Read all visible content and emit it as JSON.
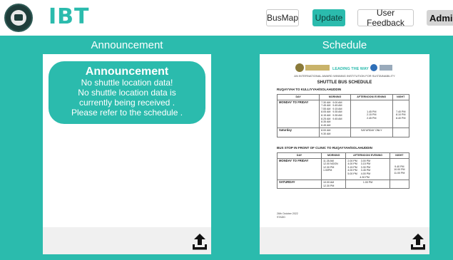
{
  "header": {
    "brand": "IBT",
    "nav": {
      "busmap": "BusMap",
      "update": "Update",
      "feedback": "User Feedback",
      "admin": "Admi"
    }
  },
  "colors": {
    "teal": "#2bbbad",
    "dark": "#1f3d3a"
  },
  "left_panel": {
    "title": "Announcement",
    "bubble_title": "Announcement",
    "lines": [
      "No shuttle location data!",
      "No shuttle location data is",
      "currently being received .",
      "Please refer to the schedule ."
    ],
    "icon": "upload-icon"
  },
  "right_panel": {
    "title": "Schedule",
    "icon": "upload-icon",
    "doc": {
      "caption": "AN INTERNATIONAL AWARD WINNING INSTITUTION FOR SUSTAINABILITY",
      "logo_text": "LEADING THE WAY",
      "title": "SHUTTLE BUS SCHEDULE",
      "route1": "RUQAYYAH TO KULLIYYAH/SOLAHUDDIN",
      "route2": "BUS STOP IN FRONT OF CLINIC TO RUQAYYAH/SOLAHUDDIN",
      "headers": [
        "DAY",
        "MORNING",
        "AFTERNOON/ EVENING",
        "NIGHT"
      ],
      "t1": {
        "weekday": "MONDAY TO FRIDAY",
        "morning": "7.30 AM   9.00 AM\n7.45 AM   9.45 AM\n7.55 AM   9.15 AM\n8.05 AM   9.35 AM\n8.15 AM   9.35 AM\n8.25 AM   9.45 AM\n8.35 AM\n8.45 AM",
        "afternoon": "1.45 PM\n2.15 PM\n2.45 PM",
        "night": "7.40 PM\n8.10 PM\n8.40 PM",
        "saturday": "Saturday",
        "sat_morning": "8.00 AM\n9.30 AM",
        "sat_afternoon": "SATURDAY ONLY"
      },
      "t2": {
        "weekday": "MONDAY TO FRIDAY",
        "morning": "11.35 AM\n12.00 NOON\n12.30 PM\n1.00PM",
        "afternoon": "2.00 PM     3.00 PM\n4.00 PM     3.15 PM\n3.15 PM     3.30 PM\n4.00 PM     3.45 PM\n5.00 PM     4.00 PM\n                 4.30 PM",
        "night": "9.40 PM\n10.00 PM\n11.00 PM",
        "saturday": "SATURDAY",
        "sat_morning": "10.00 AM\n12.30 PM",
        "sat_afternoon": "1.00 PM"
      },
      "date": "26th October 2022\nSTADD"
    }
  }
}
